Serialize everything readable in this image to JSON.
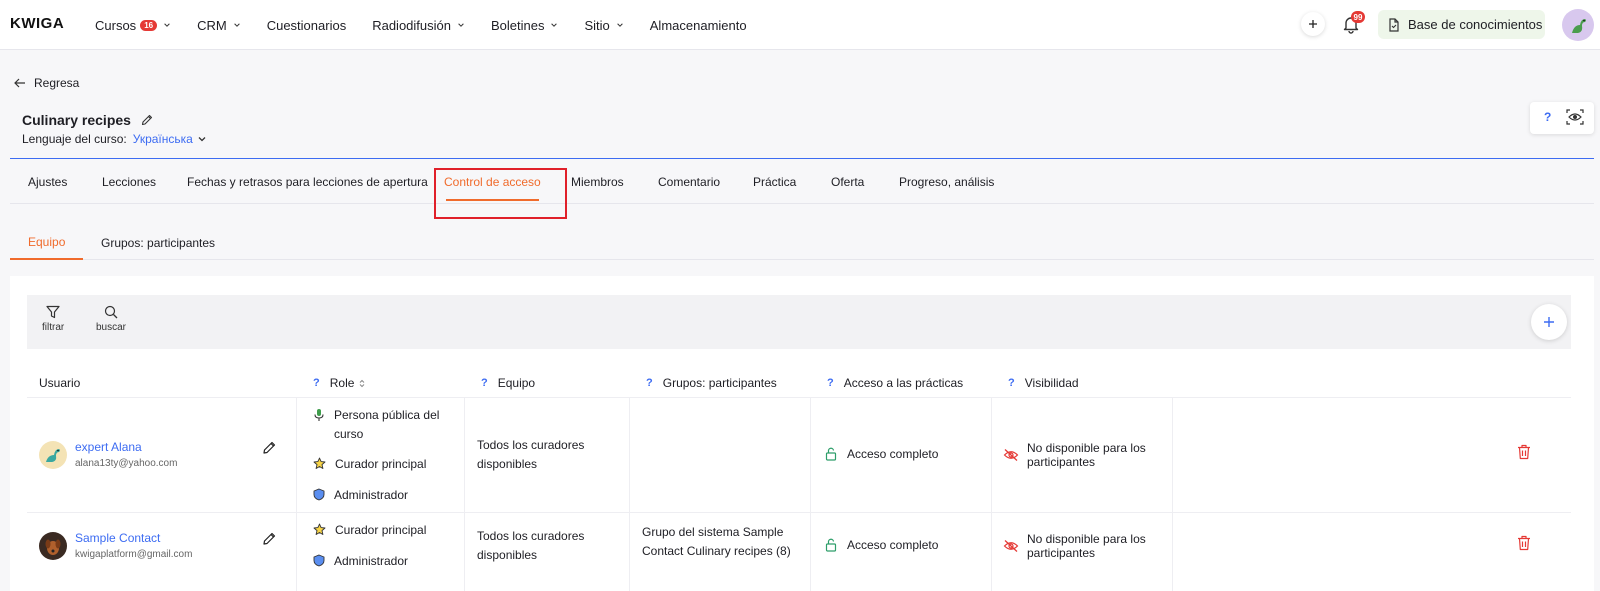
{
  "app": {
    "logo": "KWIGA"
  },
  "nav": {
    "items": [
      {
        "label": "Cursos",
        "badge": "16",
        "dropdown": true
      },
      {
        "label": "CRM",
        "dropdown": true
      },
      {
        "label": "Cuestionarios",
        "dropdown": false
      },
      {
        "label": "Radiodifusión",
        "dropdown": true
      },
      {
        "label": "Boletines",
        "dropdown": true
      },
      {
        "label": "Sitio",
        "dropdown": true
      },
      {
        "label": "Almacenamiento",
        "dropdown": false
      }
    ],
    "notifications_count": "99",
    "knowledge_base_label": "Base de conocimientos"
  },
  "header": {
    "back_label": "Regresa",
    "course_title": "Culinary recipes",
    "language_label": "Lenguaje del curso:",
    "language_value": "Українська",
    "help_label": "?"
  },
  "tabs": [
    {
      "label": "Ajustes",
      "active": false
    },
    {
      "label": "Lecciones",
      "active": false
    },
    {
      "label": "Fechas y retrasos para lecciones de apertura",
      "active": false
    },
    {
      "label": "Control de acceso",
      "active": true
    },
    {
      "label": "Miembros",
      "active": false
    },
    {
      "label": "Comentario",
      "active": false
    },
    {
      "label": "Práctica",
      "active": false
    },
    {
      "label": "Oferta",
      "active": false
    },
    {
      "label": "Progreso, análisis",
      "active": false
    }
  ],
  "subtabs": [
    {
      "label": "Equipo",
      "active": true
    },
    {
      "label": "Grupos: participantes",
      "active": false
    }
  ],
  "toolbar": {
    "filter_label": "filtrar",
    "search_label": "buscar"
  },
  "table": {
    "columns": {
      "user": "Usuario",
      "role": "Role",
      "team": "Equipo",
      "groups": "Grupos: participantes",
      "practice": "Acceso a las prácticas",
      "visibility": "Visibilidad",
      "help_mark": "?"
    },
    "rows": [
      {
        "name": "expert Alana",
        "email": "alana13ty@yahoo.com",
        "roles": [
          "Persona pública del curso",
          "Curador principal",
          "Administrador"
        ],
        "team": "Todos los curadores disponibles",
        "groups": "",
        "practice": "Acceso completo",
        "visibility": "No disponible para los participantes"
      },
      {
        "name": "Sample Contact",
        "email": "kwigaplatform@gmail.com",
        "roles": [
          "Curador principal",
          "Administrador"
        ],
        "team": "Todos los curadores disponibles",
        "groups": "Grupo del sistema Sample Contact Culinary recipes (8)",
        "practice": "Acceso completo",
        "visibility": "No disponible para los participantes"
      }
    ]
  },
  "colors": {
    "accent": "#f06b2c",
    "link": "#3d6cf2",
    "danger": "#e53935",
    "success": "#2e9e6a"
  }
}
